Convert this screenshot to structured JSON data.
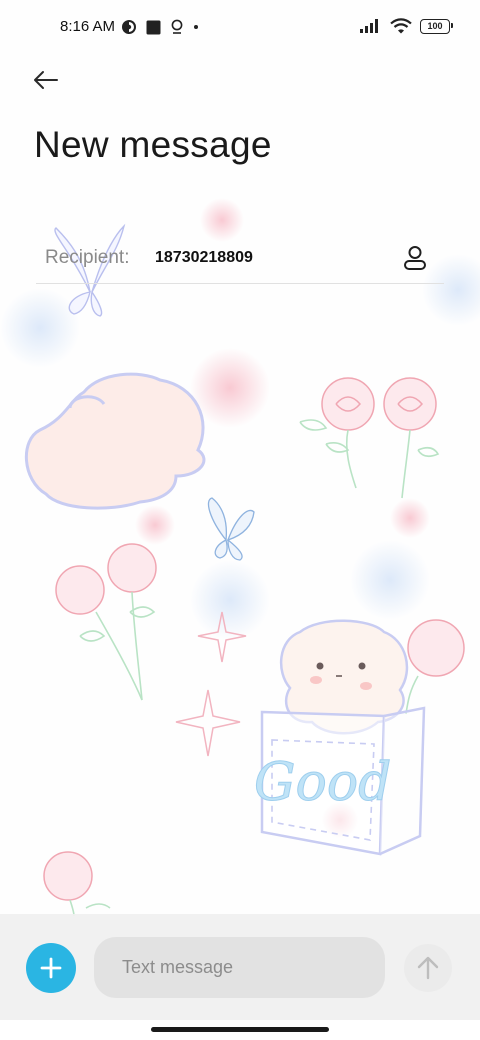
{
  "status_bar": {
    "time": "8:16 AM",
    "battery": "100",
    "icons": [
      "notification-circle-icon",
      "square-app-icon",
      "location-pin-icon",
      "dot-icon",
      "signal-icon",
      "wifi-icon",
      "battery-icon"
    ]
  },
  "header": {
    "back_icon": "arrow-left-icon",
    "title": "New message"
  },
  "recipient": {
    "label": "Recipient:",
    "value": "18730218809",
    "contact_icon": "person-icon"
  },
  "wallpaper": {
    "text": "Good"
  },
  "composer": {
    "add_icon": "plus-icon",
    "placeholder": "Text message",
    "send_icon": "arrow-up-icon"
  },
  "colors": {
    "accent": "#2ab5e3",
    "send_disabled": "#ebebeb",
    "input_bg": "#e2e2e2"
  }
}
